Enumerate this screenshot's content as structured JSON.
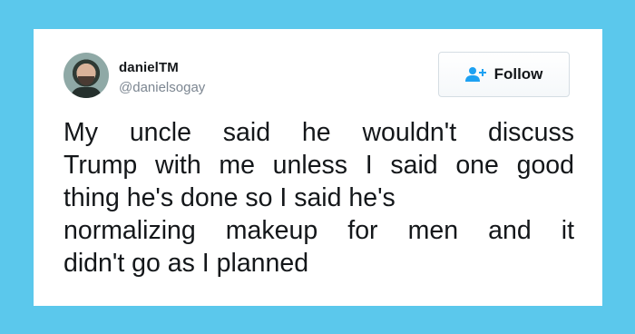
{
  "user": {
    "display_name": "danielTM",
    "handle": "@danielsogay",
    "avatar_icon": "profile-photo"
  },
  "follow_button": {
    "label": "Follow",
    "icon": "add-user-icon",
    "accent": "#1da1f2"
  },
  "tweet": {
    "lines": [
      "My uncle said he wouldn't discuss",
      "Trump with me unless I said one good",
      "thing he's done so I said he's",
      "normalizing makeup for men and it",
      "didn't go as I planned"
    ]
  },
  "colors": {
    "background": "#5bc8ec",
    "card": "#ffffff",
    "text": "#14171a",
    "muted": "#7c8691"
  }
}
